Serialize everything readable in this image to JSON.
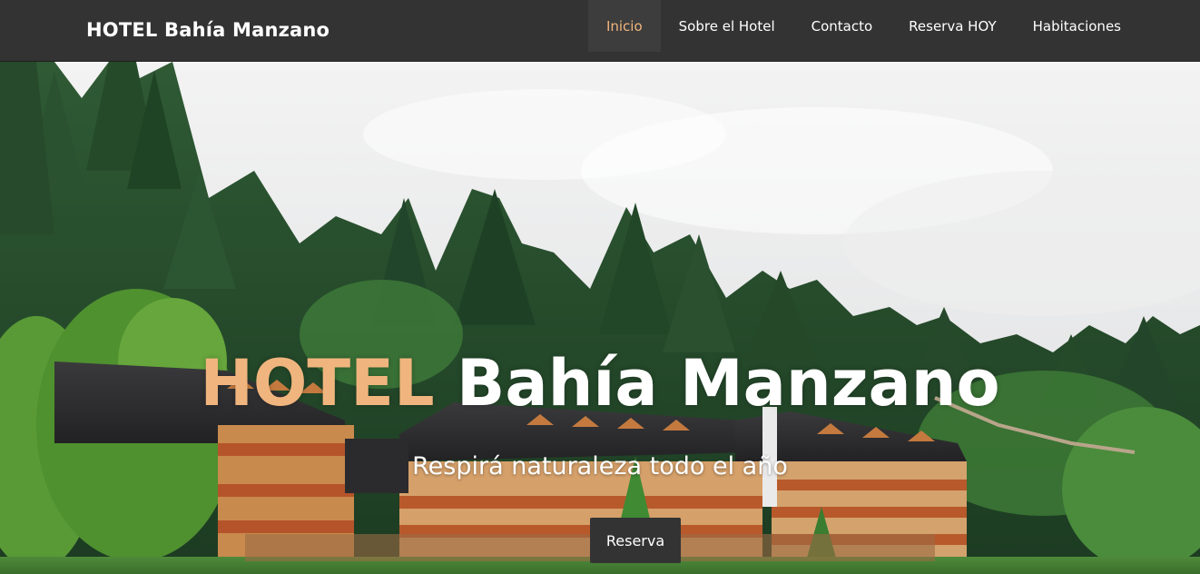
{
  "brand": {
    "name": "HOTEL Bahía Manzano"
  },
  "nav": {
    "items": [
      {
        "label": "Inicio",
        "active": true
      },
      {
        "label": "Sobre el Hotel",
        "active": false
      },
      {
        "label": "Contacto",
        "active": false
      },
      {
        "label": "Reserva HOY",
        "active": false
      },
      {
        "label": "Habitaciones",
        "active": false
      }
    ]
  },
  "hero": {
    "title_accent": "HOTEL",
    "title_rest": "Bahía Manzano",
    "subtitle": "Respirá naturaleza todo el año",
    "button_label": "Reserva"
  },
  "colors": {
    "navbar_bg": "#333333",
    "accent": "#f0b57e",
    "button_bg": "#333333"
  }
}
